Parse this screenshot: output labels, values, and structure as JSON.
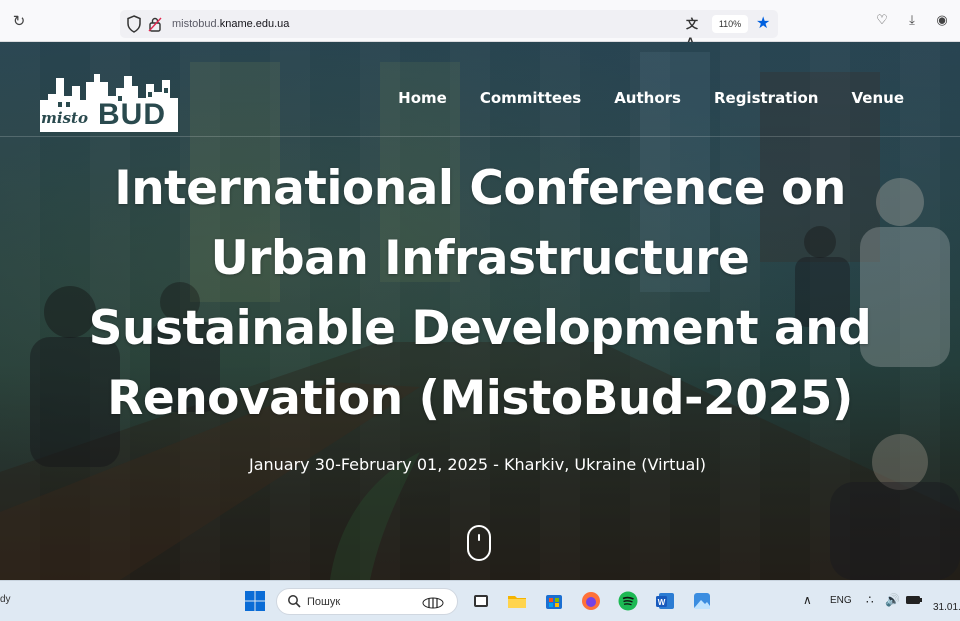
{
  "browser": {
    "url_prefix": "mistobud.",
    "url_domain": "kname.edu.ua",
    "zoom": "110%"
  },
  "site": {
    "logo_script": "misto",
    "logo_bold": "BUD",
    "nav": [
      {
        "label": "Home"
      },
      {
        "label": "Committees"
      },
      {
        "label": "Authors"
      },
      {
        "label": "Registration"
      },
      {
        "label": "Venue"
      }
    ]
  },
  "hero": {
    "title_lines": [
      "International Conference on",
      "Urban Infrastructure",
      "Sustainable Development and",
      "Renovation (MistoBud-2025)"
    ],
    "subtitle": "January 30-February 01, 2025 - Kharkiv, Ukraine (Virtual)"
  },
  "taskbar": {
    "left_text": "dy",
    "search_placeholder": "Пошук",
    "language": "ENG",
    "date_partial": "31.01."
  },
  "colors": {
    "accent_blue": "#0060df",
    "hero_overlay": "#25423f"
  }
}
